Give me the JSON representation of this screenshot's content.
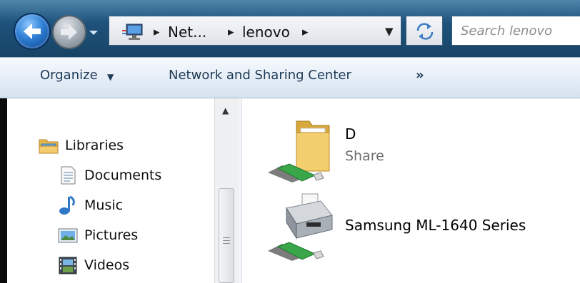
{
  "address_bar": {
    "segments": [
      "Net...",
      "lenovo"
    ],
    "icon": "network-icon"
  },
  "search": {
    "placeholder": "Search lenovo"
  },
  "toolbar": {
    "organize_label": "Organize",
    "network_sharing_label": "Network and Sharing Center",
    "more_label": "»"
  },
  "sidebar": {
    "items": [
      {
        "label": "Libraries",
        "icon": "libraries-icon"
      },
      {
        "label": "Documents",
        "icon": "documents-icon"
      },
      {
        "label": "Music",
        "icon": "music-icon"
      },
      {
        "label": "Pictures",
        "icon": "pictures-icon"
      },
      {
        "label": "Videos",
        "icon": "videos-icon"
      }
    ]
  },
  "content": {
    "items": [
      {
        "title": "D",
        "subtitle": "Share",
        "icon": "shared-folder-icon"
      },
      {
        "title": "Samsung ML-1640 Series",
        "icon": "shared-printer-icon"
      }
    ]
  },
  "colors": {
    "title_bar": "#1e5179",
    "command_bar": "#e4edf6",
    "command_text": "#1e3a57",
    "folder": "#f0c96a",
    "network_cable": "#3aa64a"
  }
}
